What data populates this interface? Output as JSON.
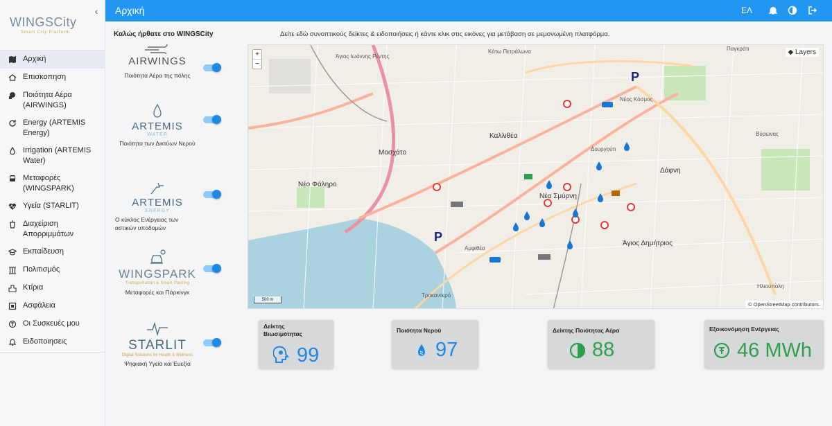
{
  "sidebar": {
    "logo": "WINGSCity",
    "logo_sub": "Smart City Platform",
    "items": [
      {
        "label": "Αρχική",
        "icon": "map-icon"
      },
      {
        "label": "Επισκοπηση",
        "icon": "home-icon"
      },
      {
        "label": "Ποιότητα Αέρα (AIRWINGS)",
        "icon": "air-icon"
      },
      {
        "label": "Energy (ARTEMIS Energy)",
        "icon": "refresh-icon"
      },
      {
        "label": "Irrigation (ARTEMIS Water)",
        "icon": "droplet-icon"
      },
      {
        "label": "Μεταφορές (WINGSPARK)",
        "icon": "bus-icon"
      },
      {
        "label": "Υγεία (STARLIT)",
        "icon": "heartbeat-icon"
      },
      {
        "label": "Διαχείριση Απορριμμάτων",
        "icon": "trash-icon"
      },
      {
        "label": "Εκπαίδευση",
        "icon": "graduation-icon"
      },
      {
        "label": "Πολιτισμός",
        "icon": "columns-icon"
      },
      {
        "label": "Κτίρια",
        "icon": "city-icon"
      },
      {
        "label": "Ασφάλεια",
        "icon": "shield-icon"
      },
      {
        "label": "Οι Συσκευές μου",
        "icon": "device-icon"
      },
      {
        "label": "Ειδοποιησεις",
        "icon": "bell-icon"
      }
    ]
  },
  "header": {
    "title": "Αρχική",
    "lang": "ΕΛ"
  },
  "welcome": "Καλώς ήρθατε στο WINGSCity",
  "hint": "Δείτε εδώ συνοπτικούς δείκτες & ειδοποιήσεις ή κάντε κλικ στις εικόνες για μετάβαση σε μεμονωμένη πλατφόρμα.",
  "platforms": [
    {
      "name": "AIRWINGS",
      "sub": "",
      "caption": "Ποιότητα Αέρα της πόλης"
    },
    {
      "name": "ARTEMIS",
      "sub": "WATER",
      "caption": "Ποιότητα των Δικτύων Νερού"
    },
    {
      "name": "ARTEMIS",
      "sub": "ENERGY",
      "caption": "Ο κύκλος Ενέργειας των αστικών υποδομών"
    },
    {
      "name": "WINGSPARK",
      "sub": "Transportation & Smart Parking",
      "caption": "Μεταφορές και Πάρκινγκ"
    },
    {
      "name": "STARLIT",
      "sub": "Digital Solutions for Health & Wellness",
      "caption": "Ψηφιακή Υγεία και Ευεξία"
    }
  ],
  "map": {
    "layers": "Layers",
    "zoom_in": "+",
    "zoom_out": "−",
    "scale": "500 m",
    "attribution": "© OpenStreetMap contributors.",
    "labels": [
      "Άγιος Ιωάννης Ρέντης",
      "Μοσχάτο",
      "Καλλιθέα",
      "Νέα Σμύρνη",
      "Δάφνη",
      "Νέο Φάληρο",
      "Αμφιθέα",
      "Άγιος Δημήτριος",
      "Δουργούτι",
      "Νέος Κόσμος",
      "Κάτω Πετράλωνα",
      "Παγκράτι",
      "Ηλιούπολη",
      "Βύρωνας",
      "Τροκαντερό"
    ]
  },
  "kpis": [
    {
      "title": "Δείκτης Βιωσιμότητας",
      "value": "99",
      "color": "#1e88e5",
      "icon": "head-icon"
    },
    {
      "title": "Ποιότητα Νερού",
      "value": "97",
      "color": "#1e88e5",
      "icon": "water-drops-icon"
    },
    {
      "title": "Δείκτης Ποιότητας Αέρα",
      "value": "88",
      "color": "#2e9e4f",
      "icon": "contrast-icon"
    },
    {
      "title": "Εξοικονόμηση Ενέργειας",
      "value": "46 MWh",
      "color": "#2e9e4f",
      "icon": "energy-icon"
    }
  ]
}
